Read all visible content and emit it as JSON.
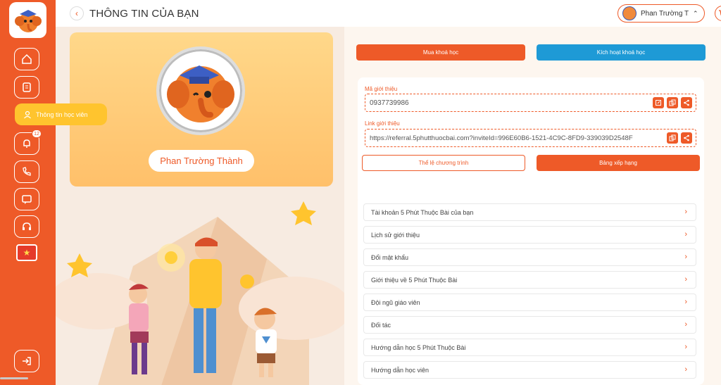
{
  "header": {
    "title": "THÔNG TIN CỦA BẠN",
    "user_name": "Phan Trường T..."
  },
  "sidebar": {
    "active_label": "Thông tin học viên",
    "notification_count": "12"
  },
  "profile": {
    "full_name": "Phan Trường Thành"
  },
  "actions": {
    "buy_label": "Mua khoá học",
    "activate_label": "Kích hoạt khoá học"
  },
  "referral": {
    "code_label": "Mã giới thiệu",
    "code_value": "0937739986",
    "link_label": "Link giới thiệu",
    "link_value": "https://referral.5phutthuocbai.com?inviteId=996E60B6-1521-4C9C-8FD9-339039D2548F",
    "rules_label": "Thể lệ chương trình",
    "ranking_label": "Bảng xếp hạng"
  },
  "menu": {
    "items": [
      {
        "label": "Tài khoản 5 Phút Thuộc Bài của bạn"
      },
      {
        "label": "Lịch sử giới thiệu"
      },
      {
        "label": "Đổi mật khẩu"
      },
      {
        "label": "Giới thiệu về 5 Phút Thuộc Bài"
      },
      {
        "label": "Đội ngũ giáo viên"
      },
      {
        "label": "Đối tác"
      },
      {
        "label": "Hướng dẫn học 5 Phút Thuộc Bài"
      },
      {
        "label": "Hướng dẫn học viên"
      }
    ]
  },
  "colors": {
    "brand_orange": "#ee5a28",
    "brand_blue": "#1e9ad6",
    "highlight_yellow": "#ffc42e"
  },
  "icons": {
    "nav": [
      "home-icon",
      "book-icon",
      "user-icon",
      "bell-icon",
      "phone-icon",
      "chat-icon",
      "headset-icon",
      "vietnam-flag-icon",
      "logout-icon"
    ],
    "referral_code_actions": [
      "edit-icon",
      "copy-icon",
      "share-icon"
    ],
    "referral_link_actions": [
      "copy-icon",
      "share-icon"
    ]
  }
}
